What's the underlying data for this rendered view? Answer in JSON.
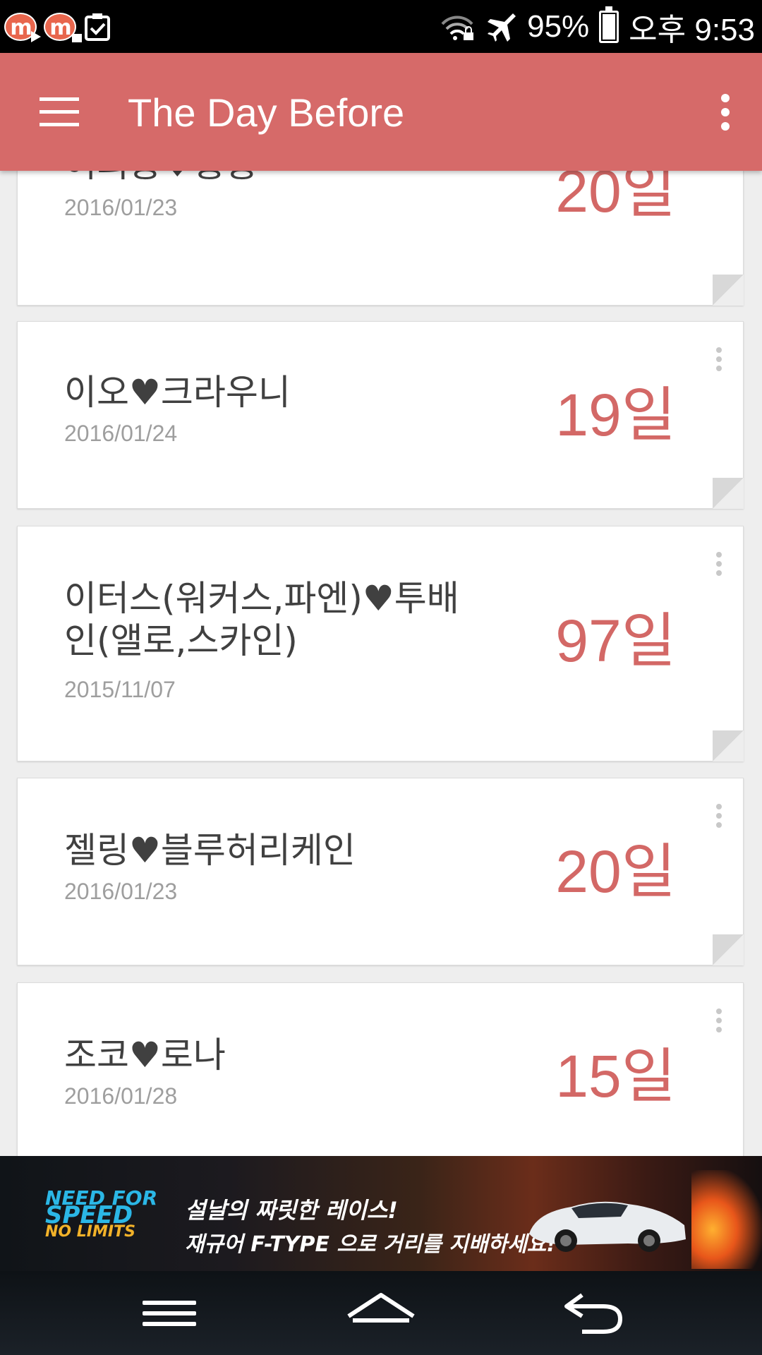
{
  "status_bar": {
    "battery": "95%",
    "time": "오후 9:53",
    "notification_icons": [
      "mm-app-icon",
      "mm-app-icon",
      "clipboard-check-icon"
    ],
    "system_icons": [
      "wifi-lock-icon",
      "airplane-icon",
      "battery-icon"
    ]
  },
  "app_bar": {
    "title": "The Day Before",
    "left_icon": "menu-icon",
    "right_icon": "overflow-menu-icon"
  },
  "items": [
    {
      "name": "여의룡♥홍룡",
      "date": "2016/01/23",
      "count": "20일"
    },
    {
      "name": "이오♥크라우니",
      "date": "2016/01/24",
      "count": "19일"
    },
    {
      "name": "이터스(워커스,파엔)♥투배인(앨로,스카인)",
      "date": "2015/11/07",
      "count": "97일"
    },
    {
      "name": "젤링♥블루허리케인",
      "date": "2016/01/23",
      "count": "20일"
    },
    {
      "name": "조코♥로나",
      "date": "2016/01/28",
      "count": "15일"
    }
  ],
  "ad": {
    "logo_line1": "NEED FOR",
    "logo_line2": "SPEED",
    "logo_line3": "NO LIMITS",
    "headline": "설날의 짜릿한 레이스!",
    "subline": "재규어 F-TYPE 으로 거리를 지배하세요!"
  },
  "nav_bar": {
    "buttons": [
      "recent-apps-icon",
      "home-icon",
      "back-icon"
    ]
  },
  "colors": {
    "app_bar": "#d66a69",
    "accent_count": "#d36866",
    "background": "#eeeeee"
  }
}
